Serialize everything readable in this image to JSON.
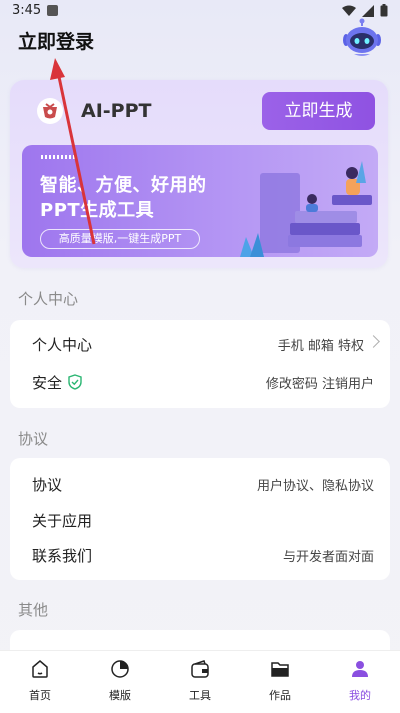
{
  "status_bar": {
    "time": "3:45"
  },
  "header": {
    "title": "立即登录"
  },
  "promo": {
    "brand_name": "AI-PPT",
    "generate_label": "立即生成",
    "banner_line1": "智能、方便、好用的",
    "banner_line2": "PPT生成工具",
    "banner_tagline": "高质量模版,一键生成PPT"
  },
  "sections": {
    "personal": {
      "title": "个人中心",
      "rows": [
        {
          "label": "个人中心",
          "value": "手机 邮箱 特权"
        },
        {
          "label": "安全",
          "value": "修改密码  注销用户"
        }
      ]
    },
    "agreement": {
      "title": "协议",
      "rows": [
        {
          "label": "协议",
          "value": "用户协议、隐私协议"
        },
        {
          "label": "关于应用",
          "value": ""
        },
        {
          "label": "联系我们",
          "value": "与开发者面对面"
        }
      ]
    },
    "other": {
      "title": "其他"
    }
  },
  "tabs": [
    {
      "label": "首页",
      "icon": "home-icon"
    },
    {
      "label": "模版",
      "icon": "template-icon"
    },
    {
      "label": "工具",
      "icon": "tools-icon"
    },
    {
      "label": "作品",
      "icon": "folder-icon"
    },
    {
      "label": "我的",
      "icon": "profile-icon",
      "active": true
    }
  ],
  "colors": {
    "accent": "#8f52e2",
    "banner": "#9e76ee",
    "annotation_arrow": "#d9343a"
  }
}
